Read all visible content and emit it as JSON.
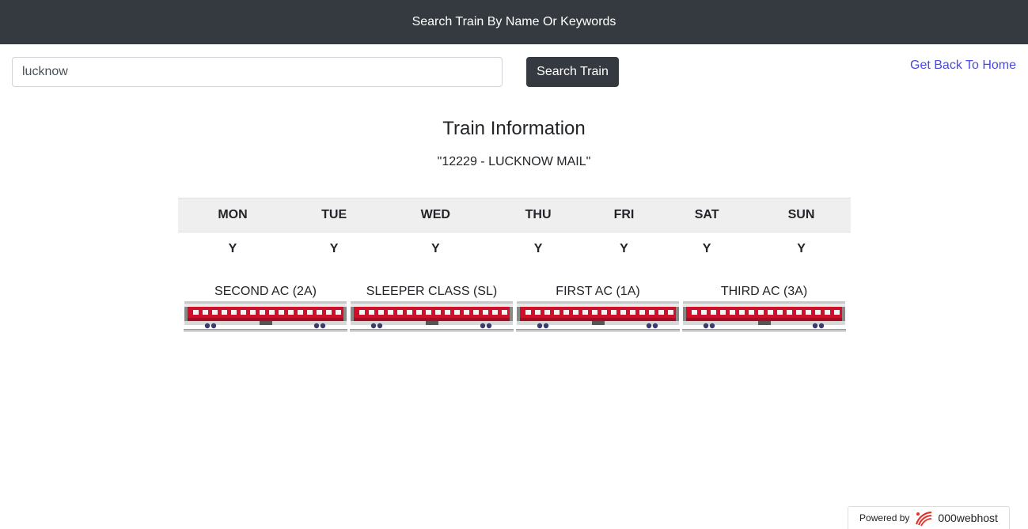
{
  "header": {
    "title": "Search Train By Name Or Keywords"
  },
  "search": {
    "value": "lucknow",
    "button_label": "Search Train"
  },
  "home_link": {
    "label": "Get Back To Home"
  },
  "info": {
    "heading": "Train Information",
    "train": "\"12229 - LUCKNOW MAIL\""
  },
  "schedule": {
    "days": [
      "MON",
      "TUE",
      "WED",
      "THU",
      "FRI",
      "SAT",
      "SUN"
    ],
    "runs": [
      "Y",
      "Y",
      "Y",
      "Y",
      "Y",
      "Y",
      "Y"
    ]
  },
  "classes": [
    {
      "label": "SECOND AC (2A)"
    },
    {
      "label": "SLEEPER CLASS (SL)"
    },
    {
      "label": "FIRST AC (1A)"
    },
    {
      "label": "THIRD AC (3A)"
    }
  ],
  "footer": {
    "powered_label": "Powered by",
    "brand": "000webhost"
  },
  "colors": {
    "navbar": "#343a40",
    "link": "#4a4ae0",
    "coach_red": "#d0102a",
    "table_head": "#efefef"
  }
}
